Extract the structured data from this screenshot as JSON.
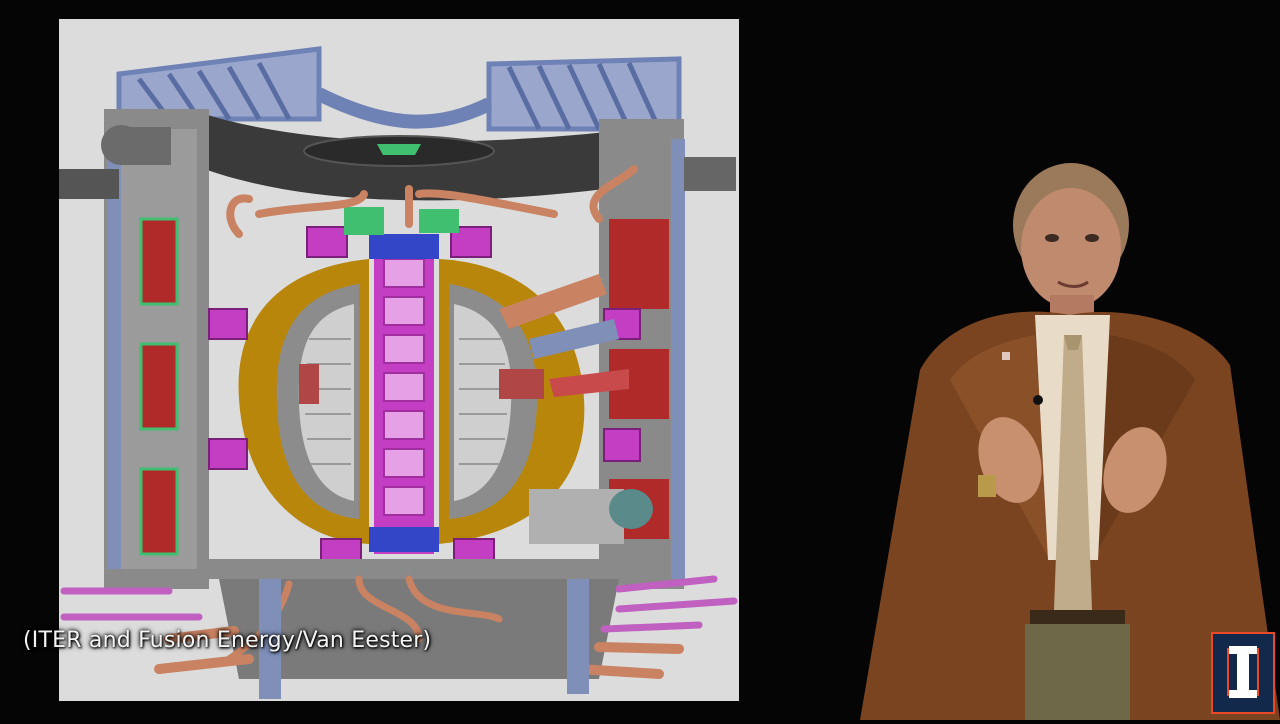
{
  "caption": "(ITER and Fusion Energy/Van Eester)",
  "diagram": {
    "subject": "tokamak-cutaway-illustration",
    "colors": {
      "panel_background": "#dcdcdc",
      "steel_frame": "#7f8fb8",
      "cryostat_gray": "#8a8a8a",
      "magnet_gold": "#b8860b",
      "coil_magenta": "#c43ec4",
      "coil_red": "#b02a2a",
      "pipe_copper": "#c98262",
      "accent_green": "#3fbf6f",
      "accent_blue": "#3446c8"
    }
  },
  "presenter": {
    "description_icon": "presenter-figure"
  },
  "logo": {
    "name": "illinois-block-i-icon",
    "colors": {
      "background": "#13294b",
      "border": "#e84a27",
      "mark": "#ffffff"
    }
  }
}
